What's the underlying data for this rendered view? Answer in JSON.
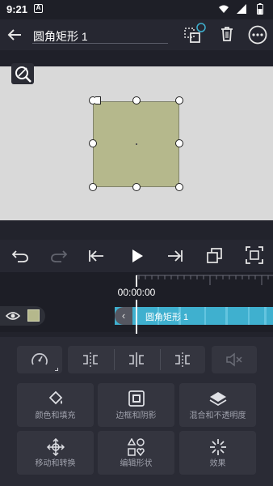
{
  "status_bar": {
    "time": "9:21",
    "app_badge": "A"
  },
  "appbar": {
    "title": "圆角矩形 1"
  },
  "timeline": {
    "timecode": "00:00:00",
    "clip_label": "圆角矩形 1"
  },
  "tools": {
    "fill": "颜色和填充",
    "border": "边框和阴影",
    "blend": "混合和不透明度",
    "move": "移动和转换",
    "edit_shape": "编辑形状",
    "effects": "效果"
  },
  "colors": {
    "accent": "#3fb0cf",
    "shape_fill": "#b5b88c",
    "swatch": "#b5b88c"
  }
}
